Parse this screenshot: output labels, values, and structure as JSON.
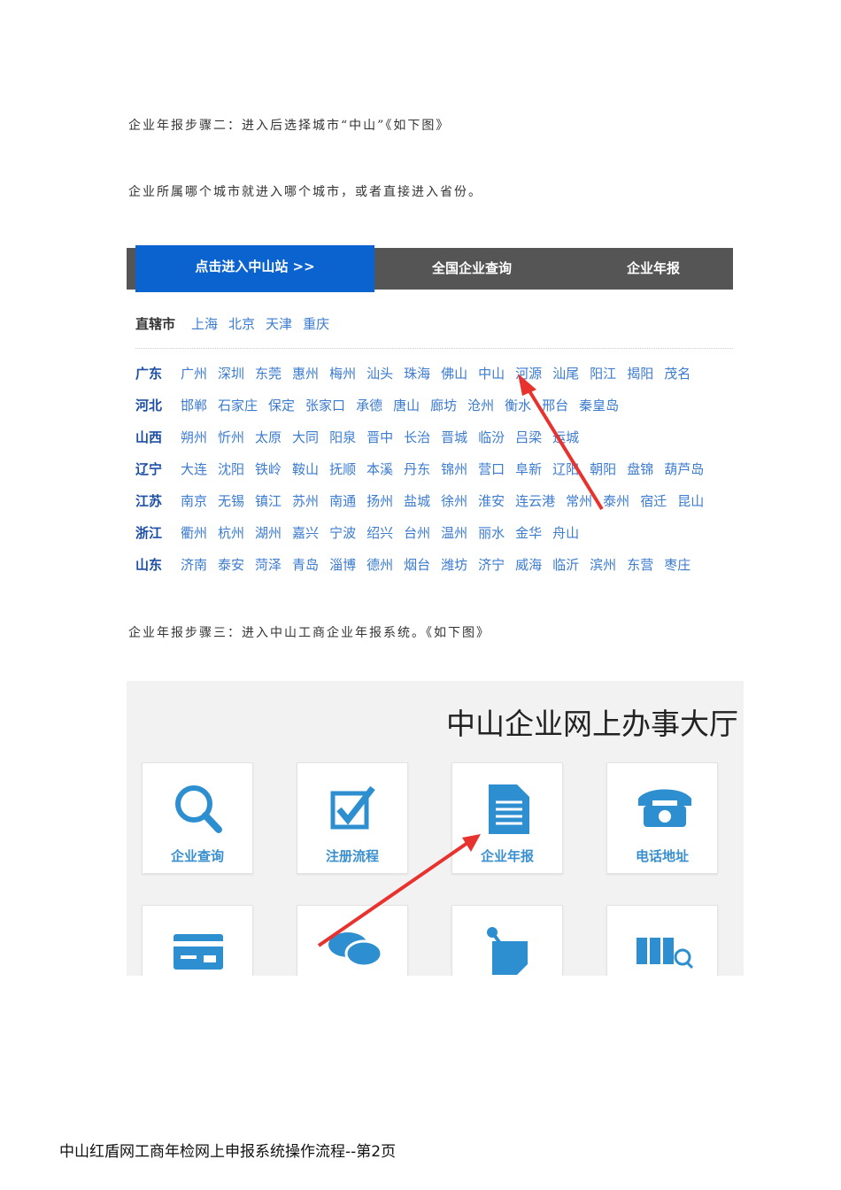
{
  "step2_text": "企业年报步骤二：进入后选择城市“中山”《如下图》",
  "note_text": "企业所属哪个城市就进入哪个城市，或者直接进入省份。",
  "shot1": {
    "tabs": [
      "点击进入中山站 >>",
      "全国企业查询",
      "企业年报"
    ],
    "municipalities_label": "直辖市",
    "municipalities": [
      "上海",
      "北京",
      "天津",
      "重庆"
    ],
    "provinces": [
      {
        "name": "广东",
        "cities": [
          "广州",
          "深圳",
          "东莞",
          "惠州",
          "梅州",
          "汕头",
          "珠海",
          "佛山",
          "中山",
          "河源",
          "汕尾",
          "阳江",
          "揭阳",
          "茂名"
        ]
      },
      {
        "name": "河北",
        "cities": [
          "邯郸",
          "石家庄",
          "保定",
          "张家口",
          "承德",
          "唐山",
          "廊坊",
          "沧州",
          "衡水",
          "邢台",
          "秦皇岛"
        ]
      },
      {
        "name": "山西",
        "cities": [
          "朔州",
          "忻州",
          "太原",
          "大同",
          "阳泉",
          "晋中",
          "长治",
          "晋城",
          "临汾",
          "吕梁",
          "运城"
        ]
      },
      {
        "name": "辽宁",
        "cities": [
          "大连",
          "沈阳",
          "铁岭",
          "鞍山",
          "抚顺",
          "本溪",
          "丹东",
          "锦州",
          "营口",
          "阜新",
          "辽阳",
          "朝阳",
          "盘锦",
          "葫芦岛"
        ]
      },
      {
        "name": "江苏",
        "cities": [
          "南京",
          "无锡",
          "镇江",
          "苏州",
          "南通",
          "扬州",
          "盐城",
          "徐州",
          "淮安",
          "连云港",
          "常州",
          "泰州",
          "宿迁",
          "昆山"
        ]
      },
      {
        "name": "浙江",
        "cities": [
          "衢州",
          "杭州",
          "湖州",
          "嘉兴",
          "宁波",
          "绍兴",
          "台州",
          "温州",
          "丽水",
          "金华",
          "舟山"
        ]
      },
      {
        "name": "山东",
        "cities": [
          "济南",
          "泰安",
          "菏泽",
          "青岛",
          "淄博",
          "德州",
          "烟台",
          "潍坊",
          "济宁",
          "威海",
          "临沂",
          "滨州",
          "东营",
          "枣庄"
        ]
      }
    ]
  },
  "step3_text": "企业年报步骤三：进入中山工商企业年报系统。《如下图》",
  "shot2": {
    "title": "中山企业网上办事大厅",
    "cards": [
      "企业查询",
      "注册流程",
      "企业年报",
      "电话地址"
    ]
  },
  "footer": "中山红盾网工商年检网上申报系统操作流程--第2页",
  "colors": {
    "tab_active": "#0b63cf",
    "tab_bar": "#555555",
    "link": "#3b7bd0",
    "icon": "#2d8fd0",
    "arrow": "#e8322d"
  }
}
